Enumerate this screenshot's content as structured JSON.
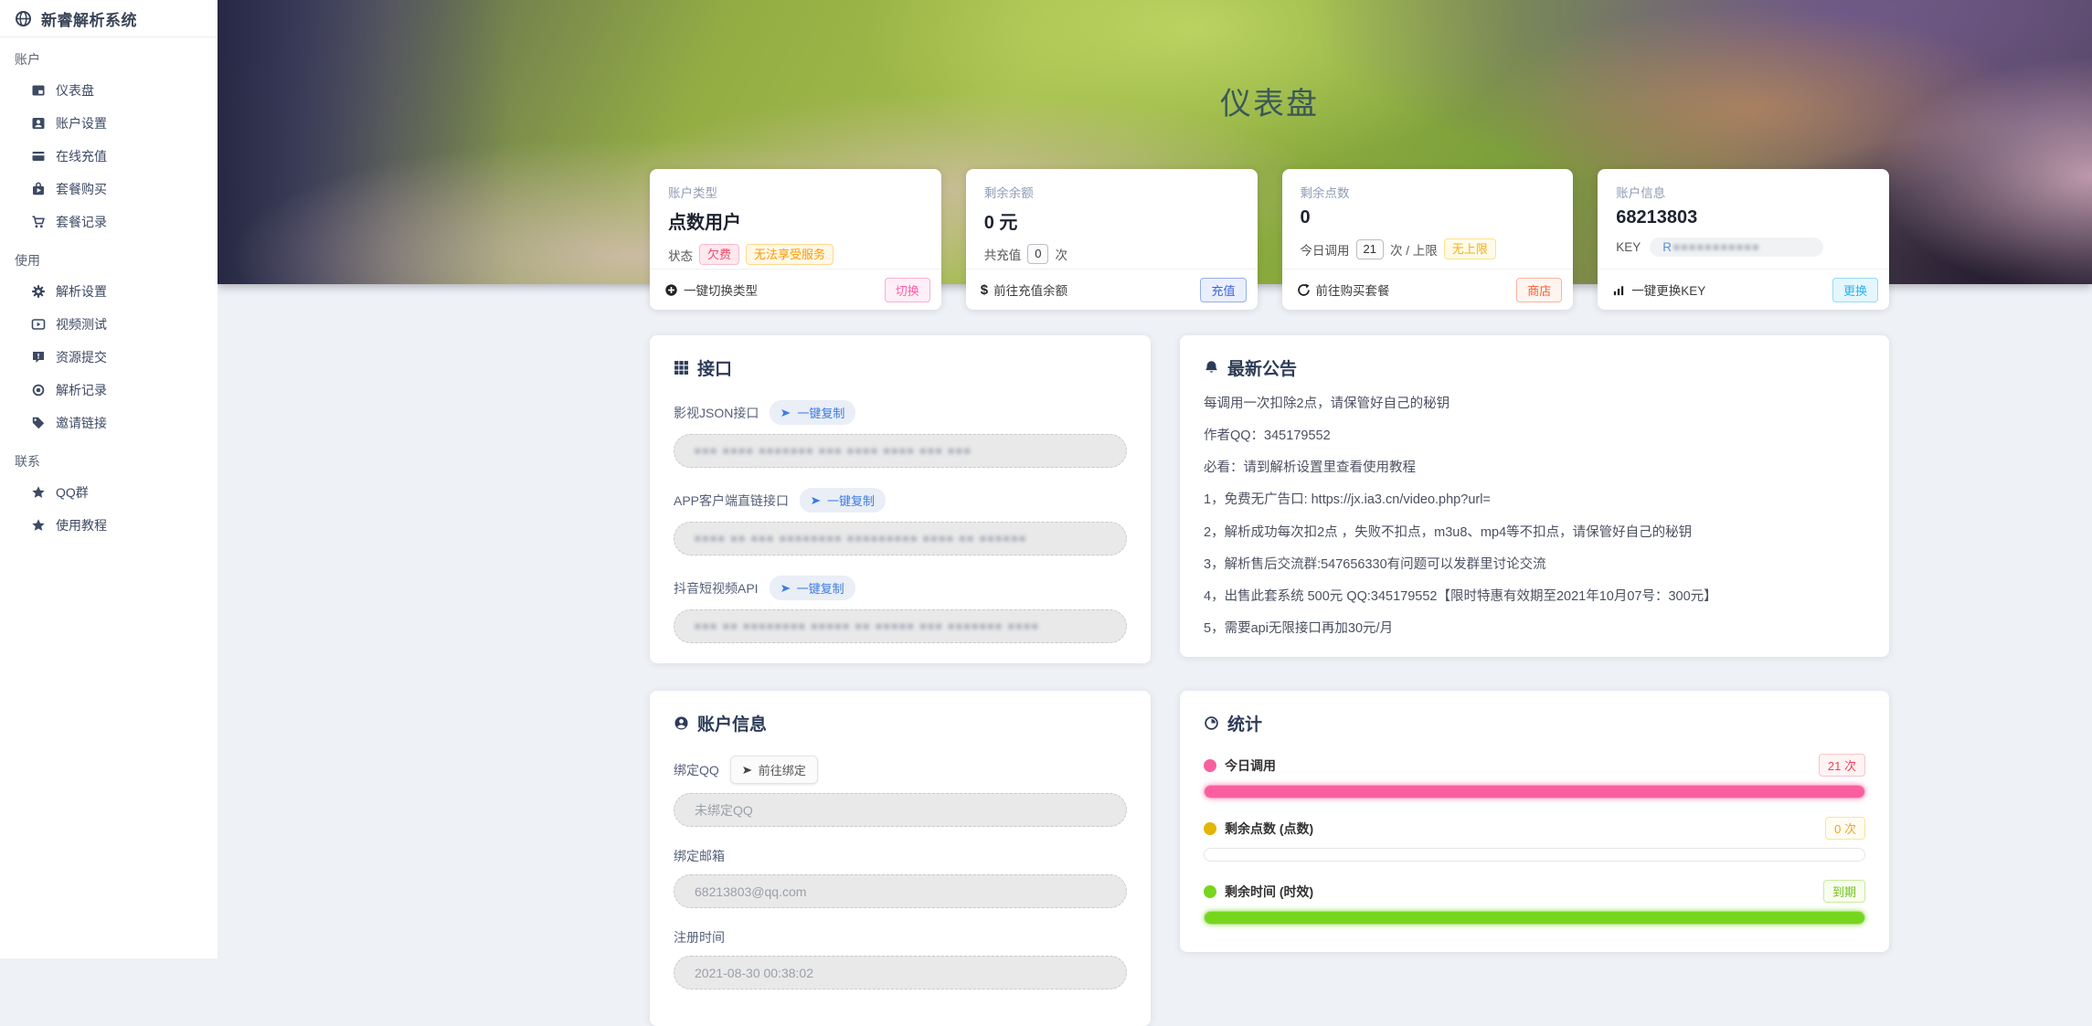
{
  "app": {
    "name": "新睿解析系统"
  },
  "sidebar": {
    "sections": [
      {
        "label": "账户",
        "items": [
          {
            "icon": "dashboard-icon",
            "label": "仪表盘"
          },
          {
            "icon": "account-card-icon",
            "label": "账户设置"
          },
          {
            "icon": "credit-card-icon",
            "label": "在线充值"
          },
          {
            "icon": "package-buy-icon",
            "label": "套餐购买"
          },
          {
            "icon": "cart-icon",
            "label": "套餐记录"
          }
        ]
      },
      {
        "label": "使用",
        "items": [
          {
            "icon": "gear-icon",
            "label": "解析设置"
          },
          {
            "icon": "video-icon",
            "label": "视频测试"
          },
          {
            "icon": "feedback-icon",
            "label": "资源提交"
          },
          {
            "icon": "eye-icon",
            "label": "解析记录"
          },
          {
            "icon": "tag-icon",
            "label": "邀请链接"
          }
        ]
      },
      {
        "label": "联系",
        "items": [
          {
            "icon": "star-icon",
            "label": "QQ群"
          },
          {
            "icon": "star-icon",
            "label": "使用教程"
          }
        ]
      }
    ]
  },
  "hero": {
    "title": "仪表盘"
  },
  "stat_cards": {
    "account_type": {
      "label": "账户类型",
      "value": "点数用户",
      "status_label": "状态",
      "badge_overdue": "欠费",
      "badge_no_service": "无法享受服务",
      "footer_text": "一键切换类型",
      "footer_button": "切换"
    },
    "balance": {
      "label": "剩余余额",
      "value": "0 元",
      "line_prefix": "共充值",
      "line_count": "0",
      "line_suffix": "次",
      "footer_text": "前往充值余额",
      "footer_button": "充值"
    },
    "points": {
      "label": "剩余点数",
      "value": "0",
      "line_prefix": "今日调用",
      "line_count": "21",
      "line_middle": "次 / 上限",
      "line_badge": "无上限",
      "footer_text": "前往购买套餐",
      "footer_button": "商店"
    },
    "account_info": {
      "label": "账户信息",
      "value": "68213803",
      "key_label": "KEY",
      "key_prefix": "R",
      "key_masked": "■■■■■■■■■■■",
      "footer_text": "一键更换KEY",
      "footer_button": "更换"
    }
  },
  "interface_panel": {
    "title": "接口",
    "copy_label": "一键复制",
    "fields": [
      {
        "label": "影视JSON接口",
        "masked_value": "■■■ ■■■■ ■■■■■■■ ■■■ ■■■■ ■■■■ ■■■ ■■■"
      },
      {
        "label": "APP客户端直链接口",
        "masked_value": "■■■■ ■■ ■■■ ■■■■■■■■ ■■■■■■■■■ ■■■■ ■■ ■■■■■■"
      },
      {
        "label": "抖音短视频API",
        "masked_value": "■■■ ■■ ■■■■■■■■ ■■■■■ ■■ ■■■■■ ■■■ ■■■■■■■ ■■■■"
      }
    ]
  },
  "announcement_panel": {
    "title": "最新公告",
    "lines": [
      "每调用一次扣除2点，请保管好自己的秘钥",
      "作者QQ：345179552",
      "必看：请到解析设置里查看使用教程",
      "1，免费无广告口: https://jx.ia3.cn/video.php?url=",
      "2，解析成功每次扣2点 ，失败不扣点，m3u8、mp4等不扣点，请保管好自己的秘钥",
      "3，解析售后交流群:547656330有问题可以发群里讨论交流",
      "4，出售此套系统 500元 QQ:345179552【限时特惠有效期至2021年10月07号：300元】",
      "5，需要api无限接口再加30元/月"
    ]
  },
  "account_panel": {
    "title": "账户信息",
    "qq_label": "绑定QQ",
    "qq_bind_button": "前往绑定",
    "qq_value": "未绑定QQ",
    "email_label": "绑定邮箱",
    "email_value": "68213803@qq.com",
    "reg_label": "注册时间",
    "reg_value": "2021-08-30 00:38:02"
  },
  "stats_panel": {
    "title": "统计",
    "rows": [
      {
        "label": "今日调用",
        "badge": "21 次",
        "fill_percent": 100,
        "color": "#f95f9e"
      },
      {
        "label": "剩余点数 (点数)",
        "badge": "0 次",
        "fill_percent": 0,
        "color": "#e3b505"
      },
      {
        "label": "剩余时间 (时效)",
        "badge": "到期",
        "fill_percent": 100,
        "color": "#76d61d"
      }
    ]
  },
  "colors": {
    "accent_pink": "#ff5ca8",
    "accent_blue": "#3a67d6",
    "accent_orange": "#ff5a2c",
    "accent_cyan": "#27b3ea",
    "bar_pink": "#f95f9e",
    "bar_green": "#76d61d",
    "dot_yellow": "#e3b505",
    "page_bg": "#eef1f6",
    "sidebar_text": "#3d4a63",
    "heading_text": "#2d3b58"
  }
}
